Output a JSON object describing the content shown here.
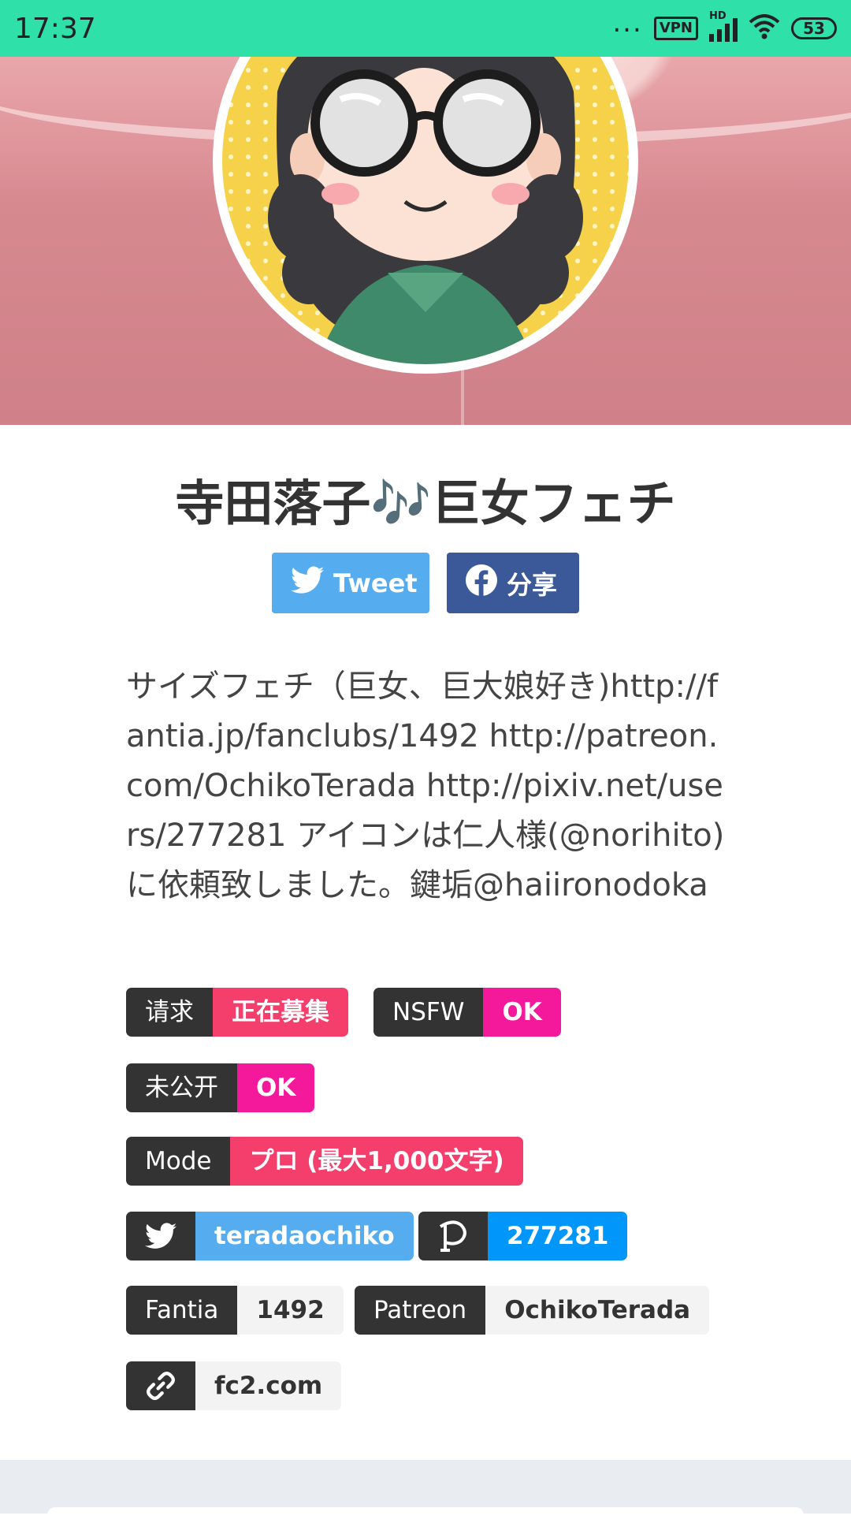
{
  "status_bar": {
    "time": "17:37",
    "dots": "...",
    "vpn": "VPN",
    "hd": "HD",
    "battery": "53"
  },
  "profile": {
    "name": "寺田落子🎶巨女フェチ",
    "tweet_label": "Tweet",
    "share_label": "分享",
    "bio": "サイズフェチ（巨女、巨大娘好き)http://fantia.jp/fanclubs/1492 http://patreon.com/OchikoTerada http://pixiv.net/users/277281 アイコンは仁人様(@norihito)に依頼致しました。鍵垢@haiironodoka"
  },
  "tags": {
    "request": {
      "key": "请求",
      "value": "正在募集"
    },
    "nsfw": {
      "key": "NSFW",
      "value": "OK"
    },
    "unpublished": {
      "key": "未公开",
      "value": "OK"
    },
    "mode": {
      "key": "Mode",
      "value": "プロ (最大1,000文字)"
    },
    "twitter": {
      "icon": "twitter-icon",
      "value": "teradaochiko"
    },
    "pixiv": {
      "icon": "pixiv-icon",
      "value": "277281"
    },
    "fantia": {
      "key": "Fantia",
      "value": "1492"
    },
    "patreon": {
      "key": "Patreon",
      "value": "OchikoTerada"
    },
    "website": {
      "icon": "link-icon",
      "value": "fc2.com"
    }
  },
  "colors": {
    "status_bar": "#2fe0a9",
    "twitter": "#55acee",
    "facebook": "#3b5998",
    "pink": "#f43f6d",
    "magenta": "#f4189b",
    "pixiv": "#0096fa"
  }
}
